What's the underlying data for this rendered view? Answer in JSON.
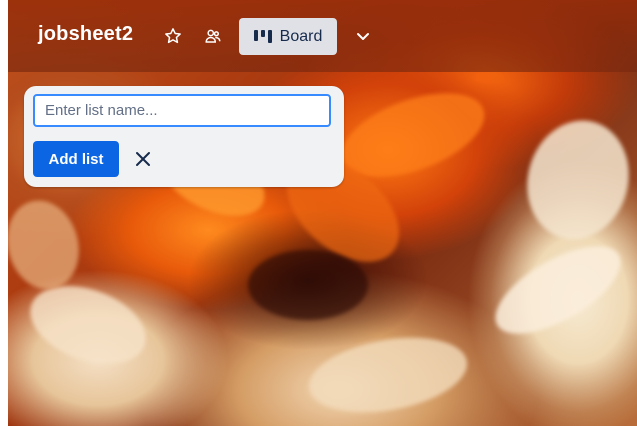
{
  "board": {
    "title": "jobsheet2",
    "view_label": "Board"
  },
  "icons": {
    "star": "star-icon",
    "visibility": "workspace-visibility-icon",
    "board_view": "board-view-icon",
    "chevron": "chevron-down-icon",
    "close": "close-icon"
  },
  "add_list": {
    "placeholder": "Enter list name...",
    "value": "",
    "submit_label": "Add list"
  },
  "colors": {
    "primary_button": "#0c66e4",
    "input_focus_border": "#388bff",
    "panel_background": "#f1f2f4",
    "view_button_background": "#dfe1e6"
  }
}
